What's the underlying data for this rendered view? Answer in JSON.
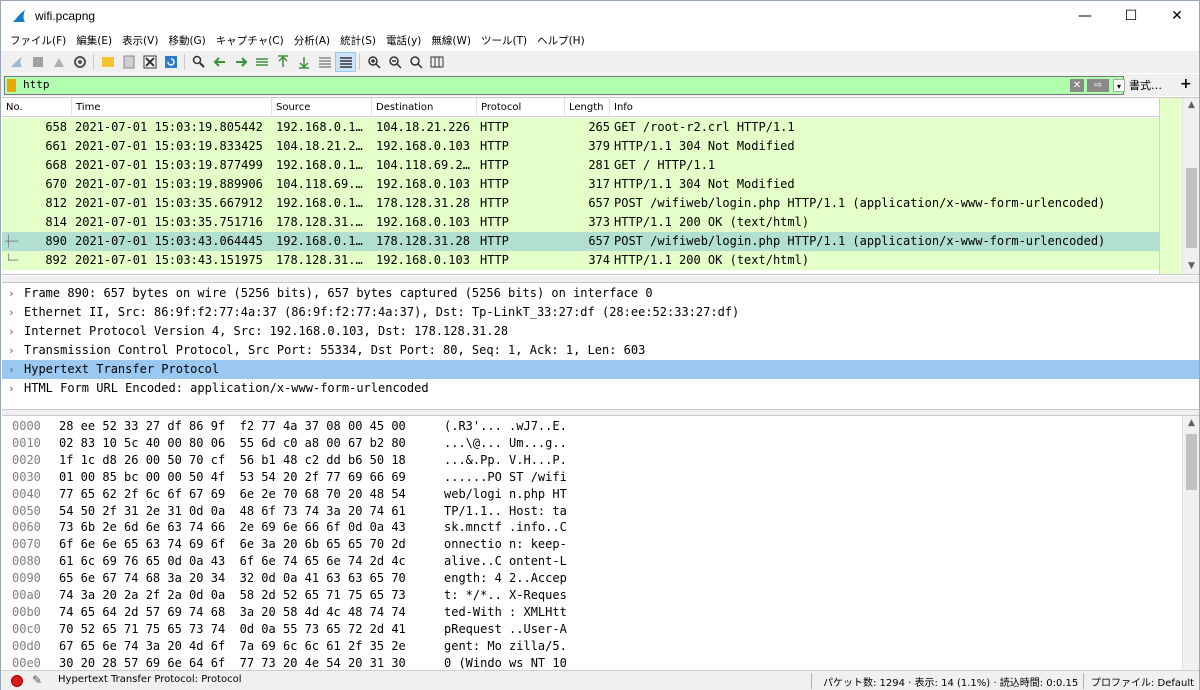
{
  "window": {
    "title": "wifi.pcapng",
    "minimize": "—",
    "maximize": "☐",
    "close": "✕"
  },
  "menu": [
    "ファイル(F)",
    "編集(E)",
    "表示(V)",
    "移動(G)",
    "キャプチャ(C)",
    "分析(A)",
    "統計(S)",
    "電話(y)",
    "無線(W)",
    "ツール(T)",
    "ヘルプ(H)"
  ],
  "filter": {
    "value": "http",
    "clear": "✕",
    "apply": "⇨",
    "dropdown": "▾",
    "expression": "書式…",
    "add": "+"
  },
  "packet_list": {
    "columns": [
      "No.",
      "Time",
      "Source",
      "Destination",
      "Protocol",
      "Length",
      "Info"
    ],
    "rows": [
      {
        "no": "658",
        "time": "2021-07-01 15:03:19.805442",
        "src": "192.168.0.1…",
        "dst": "104.18.21.226",
        "proto": "HTTP",
        "len": "265",
        "info": "GET /root-r2.crl HTTP/1.1",
        "selected": false,
        "related": ""
      },
      {
        "no": "661",
        "time": "2021-07-01 15:03:19.833425",
        "src": "104.18.21.2…",
        "dst": "192.168.0.103",
        "proto": "HTTP",
        "len": "379",
        "info": "HTTP/1.1 304 Not Modified",
        "selected": false,
        "related": ""
      },
      {
        "no": "668",
        "time": "2021-07-01 15:03:19.877499",
        "src": "192.168.0.1…",
        "dst": "104.118.69.2…",
        "proto": "HTTP",
        "len": "281",
        "info": "GET / HTTP/1.1",
        "selected": false,
        "related": ""
      },
      {
        "no": "670",
        "time": "2021-07-01 15:03:19.889906",
        "src": "104.118.69.…",
        "dst": "192.168.0.103",
        "proto": "HTTP",
        "len": "317",
        "info": "HTTP/1.1 304 Not Modified",
        "selected": false,
        "related": ""
      },
      {
        "no": "812",
        "time": "2021-07-01 15:03:35.667912",
        "src": "192.168.0.1…",
        "dst": "178.128.31.28",
        "proto": "HTTP",
        "len": "657",
        "info": "POST /wifiweb/login.php HTTP/1.1  (application/x-www-form-urlencoded)",
        "selected": false,
        "related": ""
      },
      {
        "no": "814",
        "time": "2021-07-01 15:03:35.751716",
        "src": "178.128.31.…",
        "dst": "192.168.0.103",
        "proto": "HTTP",
        "len": "373",
        "info": "HTTP/1.1 200 OK  (text/html)",
        "selected": false,
        "related": ""
      },
      {
        "no": "890",
        "time": "2021-07-01 15:03:43.064445",
        "src": "192.168.0.1…",
        "dst": "178.128.31.28",
        "proto": "HTTP",
        "len": "657",
        "info": "POST /wifiweb/login.php HTTP/1.1  (application/x-www-form-urlencoded)",
        "selected": true,
        "related": "┼─"
      },
      {
        "no": "892",
        "time": "2021-07-01 15:03:43.151975",
        "src": "178.128.31.…",
        "dst": "192.168.0.103",
        "proto": "HTTP",
        "len": "374",
        "info": "HTTP/1.1 200 OK  (text/html)",
        "selected": false,
        "related": "└─"
      }
    ]
  },
  "details": [
    {
      "text": "Frame 890: 657 bytes on wire (5256 bits), 657 bytes captured (5256 bits) on interface 0",
      "selected": false
    },
    {
      "text": "Ethernet II, Src: 86:9f:f2:77:4a:37 (86:9f:f2:77:4a:37), Dst: Tp-LinkT_33:27:df (28:ee:52:33:27:df)",
      "selected": false
    },
    {
      "text": "Internet Protocol Version 4, Src: 192.168.0.103, Dst: 178.128.31.28",
      "selected": false
    },
    {
      "text": "Transmission Control Protocol, Src Port: 55334, Dst Port: 80, Seq: 1, Ack: 1, Len: 603",
      "selected": false
    },
    {
      "text": "Hypertext Transfer Protocol",
      "selected": true
    },
    {
      "text": "HTML Form URL Encoded: application/x-www-form-urlencoded",
      "selected": false
    }
  ],
  "bytes": [
    {
      "off": "0000",
      "hex": "28 ee 52 33 27 df 86 9f  f2 77 4a 37 08 00 45 00",
      "ascii": "(.R3'... .wJ7..E."
    },
    {
      "off": "0010",
      "hex": "02 83 10 5c 40 00 80 06  55 6d c0 a8 00 67 b2 80",
      "ascii": "...\\@... Um...g.."
    },
    {
      "off": "0020",
      "hex": "1f 1c d8 26 00 50 70 cf  56 b1 48 c2 dd b6 50 18",
      "ascii": "...&.Pp. V.H...P."
    },
    {
      "off": "0030",
      "hex": "01 00 85 bc 00 00 50 4f  53 54 20 2f 77 69 66 69",
      "ascii": "......PO ST /wifi"
    },
    {
      "off": "0040",
      "hex": "77 65 62 2f 6c 6f 67 69  6e 2e 70 68 70 20 48 54",
      "ascii": "web/logi n.php HT"
    },
    {
      "off": "0050",
      "hex": "54 50 2f 31 2e 31 0d 0a  48 6f 73 74 3a 20 74 61",
      "ascii": "TP/1.1.. Host: ta"
    },
    {
      "off": "0060",
      "hex": "73 6b 2e 6d 6e 63 74 66  2e 69 6e 66 6f 0d 0a 43",
      "ascii": "sk.mnctf .info..C"
    },
    {
      "off": "0070",
      "hex": "6f 6e 6e 65 63 74 69 6f  6e 3a 20 6b 65 65 70 2d",
      "ascii": "onnectio n: keep-"
    },
    {
      "off": "0080",
      "hex": "61 6c 69 76 65 0d 0a 43  6f 6e 74 65 6e 74 2d 4c",
      "ascii": "alive..C ontent-L"
    },
    {
      "off": "0090",
      "hex": "65 6e 67 74 68 3a 20 34  32 0d 0a 41 63 63 65 70",
      "ascii": "ength: 4 2..Accep"
    },
    {
      "off": "00a0",
      "hex": "74 3a 20 2a 2f 2a 0d 0a  58 2d 52 65 71 75 65 73",
      "ascii": "t: */*.. X-Reques"
    },
    {
      "off": "00b0",
      "hex": "74 65 64 2d 57 69 74 68  3a 20 58 4d 4c 48 74 74",
      "ascii": "ted-With : XMLHtt"
    },
    {
      "off": "00c0",
      "hex": "70 52 65 71 75 65 73 74  0d 0a 55 73 65 72 2d 41",
      "ascii": "pRequest ..User-A"
    },
    {
      "off": "00d0",
      "hex": "67 65 6e 74 3a 20 4d 6f  7a 69 6c 6c 61 2f 35 2e",
      "ascii": "gent: Mo zilla/5."
    },
    {
      "off": "00e0",
      "hex": "30 20 28 57 69 6e 64 6f  77 73 20 4e 54 20 31 30",
      "ascii": "0 (Windo ws NT 10"
    }
  ],
  "status": {
    "text": "Hypertext Transfer Protocol: Protocol",
    "stats": "パケット数: 1294 · 表示: 14 (1.1%) · 読込時間: 0:0.15",
    "profile": "プロファイル: Default"
  },
  "colors": {
    "http_row": "#e4ffc7",
    "selected_row": "#b2e0d0",
    "selected_detail": "#9ac8f0",
    "filter_bg": "#afffaf"
  }
}
